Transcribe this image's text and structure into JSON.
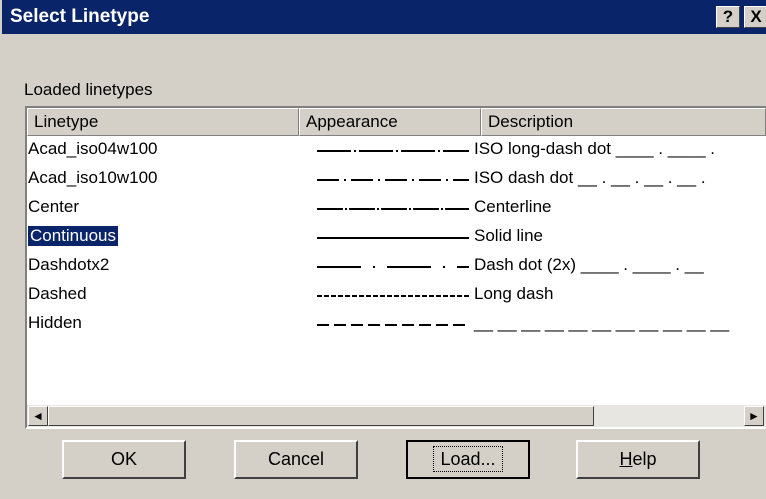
{
  "window": {
    "title": "Select Linetype",
    "help_glyph": "?",
    "close_glyph": "X"
  },
  "group_label": "Loaded linetypes",
  "columns": {
    "linetype": "Linetype",
    "appearance": "Appearance",
    "description": "Description"
  },
  "linetypes": [
    {
      "name": "Acad_iso04w100",
      "description": "ISO long-dash dot ____ . ____ .",
      "pattern": "long-dash-dot"
    },
    {
      "name": "Acad_iso10w100",
      "description": "ISO dash dot __ . __ . __ . __ .",
      "pattern": "dash-dot"
    },
    {
      "name": "Center",
      "description": "Centerline",
      "pattern": "center"
    },
    {
      "name": "Continuous",
      "description": "Solid line",
      "pattern": "solid",
      "selected": true
    },
    {
      "name": "Dashdotx2",
      "description": "Dash dot (2x) ____ . ____ . __",
      "pattern": "dashdot-2x"
    },
    {
      "name": "Dashed",
      "description": "Long dash",
      "pattern": "dashed"
    },
    {
      "name": "Hidden",
      "description": "__ __ __ __ __ __ __ __ __ __ __",
      "pattern": "hidden"
    }
  ],
  "scrollbar": {
    "left_arrow": "◄",
    "right_arrow": "►"
  },
  "buttons": {
    "ok": "OK",
    "cancel": "Cancel",
    "load": "Load...",
    "help_first": "H",
    "help_rest": "elp"
  },
  "colors": {
    "titlebar": "#0a246a",
    "selection": "#0a246a",
    "dialog_face": "#d4d0c8"
  }
}
